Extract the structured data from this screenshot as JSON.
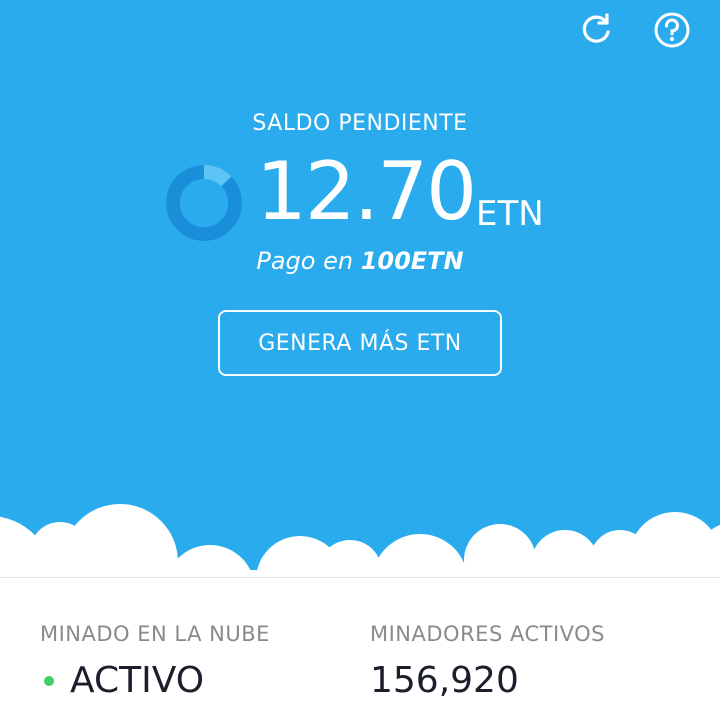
{
  "colors": {
    "hero_background": "#2aabed",
    "active_dot": "#3ecf6a",
    "ring_fill": "#1a8fd9",
    "ring_track": "#5ec3f5"
  },
  "header": {
    "refresh_icon": "refresh-icon",
    "help_icon": "help-icon"
  },
  "balance": {
    "label": "SALDO PENDIENTE",
    "amount": "12.70",
    "unit": "ETN",
    "payout_prefix": "Pago en",
    "payout_value": "100ETN",
    "progress_fraction": 0.127
  },
  "actions": {
    "generate_more": "GENERA MÁS ETN"
  },
  "stats": {
    "cloud_mining_label": "MINADO EN LA NUBE",
    "cloud_mining_status": "ACTIVO",
    "active_miners_label": "MINADORES ACTIVOS",
    "active_miners_value": "156,920"
  }
}
